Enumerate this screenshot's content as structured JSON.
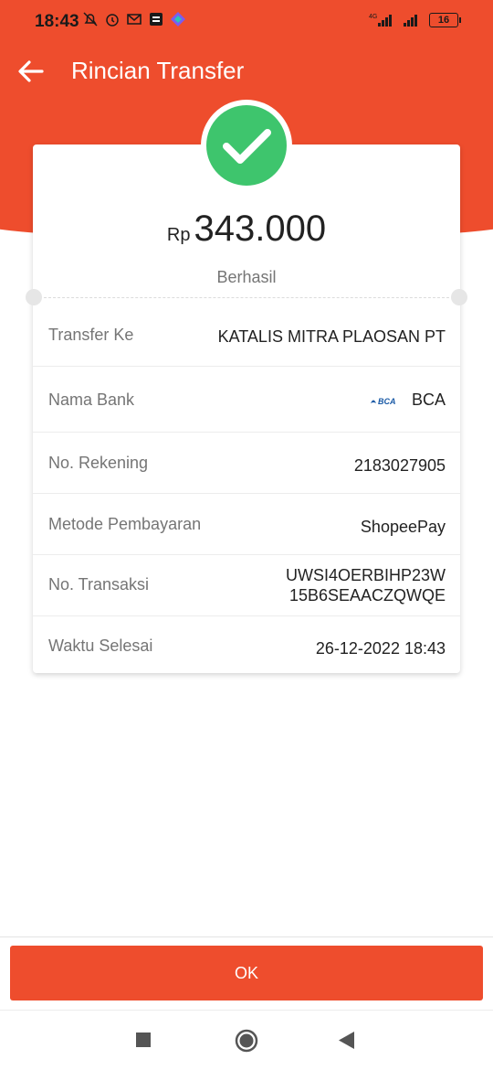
{
  "status_bar": {
    "time": "18:43",
    "battery": "16",
    "network": "4G"
  },
  "app_bar": {
    "title": "Rincian Transfer"
  },
  "summary": {
    "currency": "Rp",
    "amount": "343.000",
    "status": "Berhasil"
  },
  "details": {
    "transfer_to": {
      "label": "Transfer Ke",
      "value": "KATALIS MITRA PLAOSAN PT"
    },
    "bank": {
      "label": "Nama Bank",
      "value": "BCA",
      "logo_text": "BCA"
    },
    "account": {
      "label": "No. Rekening",
      "value": "2183027905"
    },
    "payment_method": {
      "label": "Metode Pembayaran",
      "value": "ShopeePay"
    },
    "transaction": {
      "label": "No. Transaksi",
      "value_line1": "UWSI4OERBIHP23W",
      "value_line2": "15B6SEAACZQWQE"
    },
    "completed_time": {
      "label": "Waktu Selesai",
      "value": "26-12-2022 18:43"
    }
  },
  "actions": {
    "ok_label": "OK"
  },
  "colors": {
    "brand": "#ee4d2d",
    "success": "#3ec56d",
    "bca_blue": "#1a5aa6"
  }
}
